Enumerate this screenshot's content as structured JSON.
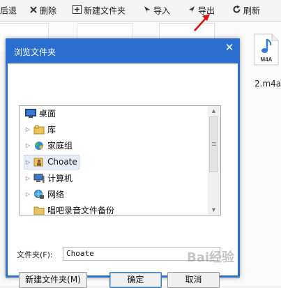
{
  "toolbar": {
    "items": [
      {
        "label": "后退",
        "icon": "back-icon"
      },
      {
        "label": "删除",
        "icon": "delete-x-icon"
      },
      {
        "label": "新建文件夹",
        "icon": "new-folder-icon"
      },
      {
        "label": "导入",
        "icon": "import-icon"
      },
      {
        "label": "导出",
        "icon": "export-icon"
      },
      {
        "label": "刷新",
        "icon": "refresh-icon"
      }
    ]
  },
  "files": {
    "m4a": {
      "badge": "M4A",
      "name": "2.m4a"
    }
  },
  "dialog": {
    "title": "浏览文件夹",
    "close_icon": "close-icon",
    "tree": [
      {
        "label": "桌面",
        "icon": "desktop-icon",
        "expandable": false
      },
      {
        "label": "库",
        "icon": "library-icon",
        "expandable": true
      },
      {
        "label": "家庭组",
        "icon": "homegroup-icon",
        "expandable": true
      },
      {
        "label": "Choate",
        "icon": "user-folder-icon",
        "expandable": true,
        "selected": true
      },
      {
        "label": "计算机",
        "icon": "computer-icon",
        "expandable": true
      },
      {
        "label": "网络",
        "icon": "network-icon",
        "expandable": true
      },
      {
        "label": "唱吧录音文件备份",
        "icon": "folder-icon",
        "expandable": false
      }
    ],
    "folder_label": "文件夹(F):",
    "folder_value": "Choate",
    "buttons": {
      "new_folder": "新建文件夹(M)",
      "ok": "确定",
      "cancel": "取消"
    }
  },
  "colors": {
    "dialog_title_bar": "#2a6fd0",
    "arrow": "#e01010"
  }
}
